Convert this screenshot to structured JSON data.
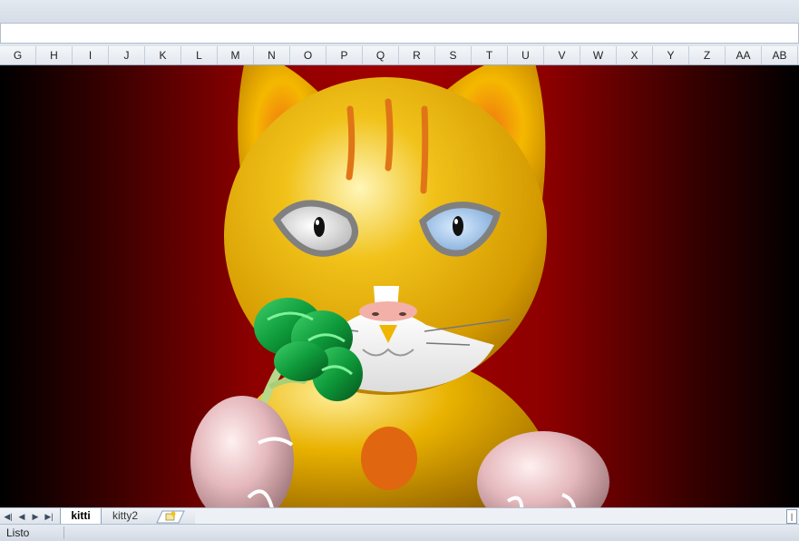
{
  "columns": [
    "G",
    "H",
    "I",
    "J",
    "K",
    "L",
    "M",
    "N",
    "O",
    "P",
    "Q",
    "R",
    "S",
    "T",
    "U",
    "V",
    "W",
    "X",
    "Y",
    "Z",
    "AA",
    "AB"
  ],
  "sheet_tabs": {
    "active": "kitti",
    "second": "kitty2"
  },
  "status": {
    "text": "Listo"
  },
  "colors": {
    "background_center": "#a10000",
    "background_edge": "#000000",
    "cat_body": "#e8b400",
    "cat_spot": "#e06a10",
    "eye_left_iris": "#dcdcdc",
    "eye_right_iris": "#8eb8e8",
    "broccoli": "#0f9a3c",
    "paws": "#e8c4c8"
  },
  "icons": {
    "nav_first": "first-sheet-icon",
    "nav_prev": "prev-sheet-icon",
    "nav_next": "next-sheet-icon",
    "nav_last": "last-sheet-icon",
    "insert_sheet": "insert-sheet-icon"
  }
}
